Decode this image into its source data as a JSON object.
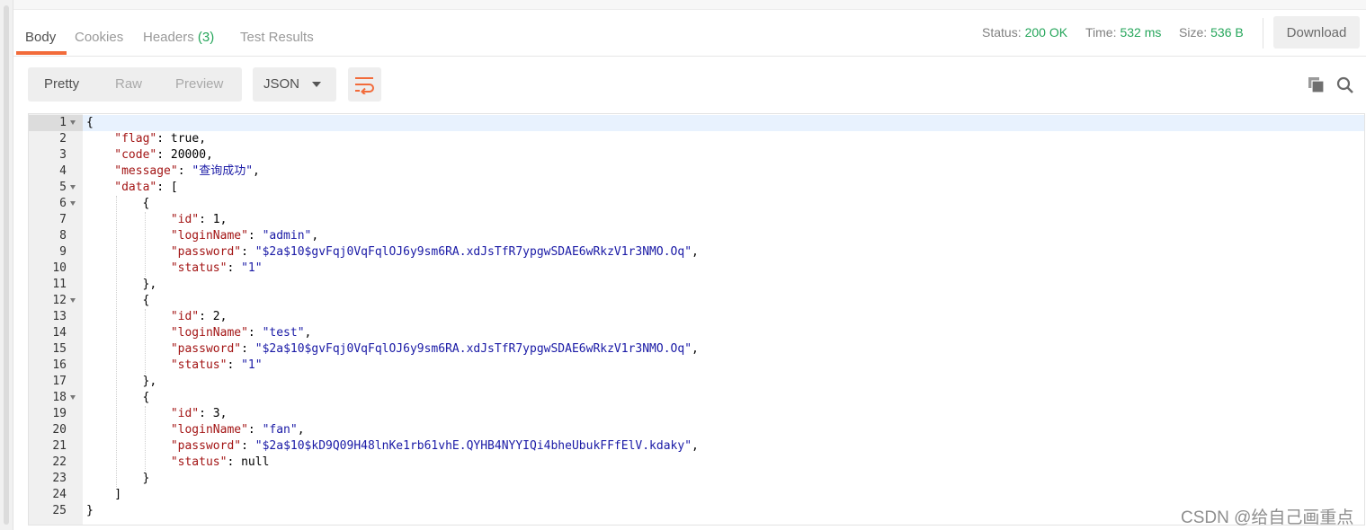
{
  "tabs": [
    {
      "label": "Body"
    },
    {
      "label": "Cookies"
    },
    {
      "label": "Headers",
      "count": "(3)"
    },
    {
      "label": "Test Results"
    }
  ],
  "response_meta": {
    "status_label": "Status:",
    "status_value": "200 OK",
    "time_label": "Time:",
    "time_value": "532 ms",
    "size_label": "Size:",
    "size_value": "536 B"
  },
  "download_label": "Download",
  "view_modes": [
    "Pretty",
    "Raw",
    "Preview"
  ],
  "format_select": {
    "selected": "JSON"
  },
  "icons": {
    "wrap": "wrap-lines-icon",
    "copy": "copy-icon",
    "search": "search-icon"
  },
  "colors": {
    "accent": "#f26b3a",
    "success": "#26a65b",
    "json_key": "#a31515",
    "json_string": "#1a1aa6"
  },
  "editor": {
    "lines": [
      {
        "n": "1",
        "indent": 0,
        "fold": true,
        "parts": [
          [
            "p",
            "{"
          ]
        ]
      },
      {
        "n": "2",
        "indent": 1,
        "parts": [
          [
            "k",
            "\"flag\""
          ],
          [
            "p",
            ": "
          ],
          [
            "l",
            "true"
          ],
          [
            "p",
            ","
          ]
        ]
      },
      {
        "n": "3",
        "indent": 1,
        "parts": [
          [
            "k",
            "\"code\""
          ],
          [
            "p",
            ": "
          ],
          [
            "l",
            "20000"
          ],
          [
            "p",
            ","
          ]
        ]
      },
      {
        "n": "4",
        "indent": 1,
        "parts": [
          [
            "k",
            "\"message\""
          ],
          [
            "p",
            ": "
          ],
          [
            "s",
            "\"查询成功\""
          ],
          [
            "p",
            ","
          ]
        ]
      },
      {
        "n": "5",
        "indent": 1,
        "fold": true,
        "parts": [
          [
            "k",
            "\"data\""
          ],
          [
            "p",
            ": ["
          ]
        ]
      },
      {
        "n": "6",
        "indent": 2,
        "fold": true,
        "parts": [
          [
            "p",
            "{"
          ]
        ]
      },
      {
        "n": "7",
        "indent": 3,
        "parts": [
          [
            "k",
            "\"id\""
          ],
          [
            "p",
            ": "
          ],
          [
            "l",
            "1"
          ],
          [
            "p",
            ","
          ]
        ]
      },
      {
        "n": "8",
        "indent": 3,
        "parts": [
          [
            "k",
            "\"loginName\""
          ],
          [
            "p",
            ": "
          ],
          [
            "s",
            "\"admin\""
          ],
          [
            "p",
            ","
          ]
        ]
      },
      {
        "n": "9",
        "indent": 3,
        "parts": [
          [
            "k",
            "\"password\""
          ],
          [
            "p",
            ": "
          ],
          [
            "s",
            "\"$2a$10$gvFqj0VqFqlOJ6y9sm6RA.xdJsTfR7ypgwSDAE6wRkzV1r3NMO.Oq\""
          ],
          [
            "p",
            ","
          ]
        ]
      },
      {
        "n": "10",
        "indent": 3,
        "parts": [
          [
            "k",
            "\"status\""
          ],
          [
            "p",
            ": "
          ],
          [
            "s",
            "\"1\""
          ]
        ]
      },
      {
        "n": "11",
        "indent": 2,
        "parts": [
          [
            "p",
            "},"
          ]
        ]
      },
      {
        "n": "12",
        "indent": 2,
        "fold": true,
        "parts": [
          [
            "p",
            "{"
          ]
        ]
      },
      {
        "n": "13",
        "indent": 3,
        "parts": [
          [
            "k",
            "\"id\""
          ],
          [
            "p",
            ": "
          ],
          [
            "l",
            "2"
          ],
          [
            "p",
            ","
          ]
        ]
      },
      {
        "n": "14",
        "indent": 3,
        "parts": [
          [
            "k",
            "\"loginName\""
          ],
          [
            "p",
            ": "
          ],
          [
            "s",
            "\"test\""
          ],
          [
            "p",
            ","
          ]
        ]
      },
      {
        "n": "15",
        "indent": 3,
        "parts": [
          [
            "k",
            "\"password\""
          ],
          [
            "p",
            ": "
          ],
          [
            "s",
            "\"$2a$10$gvFqj0VqFqlOJ6y9sm6RA.xdJsTfR7ypgwSDAE6wRkzV1r3NMO.Oq\""
          ],
          [
            "p",
            ","
          ]
        ]
      },
      {
        "n": "16",
        "indent": 3,
        "parts": [
          [
            "k",
            "\"status\""
          ],
          [
            "p",
            ": "
          ],
          [
            "s",
            "\"1\""
          ]
        ]
      },
      {
        "n": "17",
        "indent": 2,
        "parts": [
          [
            "p",
            "},"
          ]
        ]
      },
      {
        "n": "18",
        "indent": 2,
        "fold": true,
        "parts": [
          [
            "p",
            "{"
          ]
        ]
      },
      {
        "n": "19",
        "indent": 3,
        "parts": [
          [
            "k",
            "\"id\""
          ],
          [
            "p",
            ": "
          ],
          [
            "l",
            "3"
          ],
          [
            "p",
            ","
          ]
        ]
      },
      {
        "n": "20",
        "indent": 3,
        "parts": [
          [
            "k",
            "\"loginName\""
          ],
          [
            "p",
            ": "
          ],
          [
            "s",
            "\"fan\""
          ],
          [
            "p",
            ","
          ]
        ]
      },
      {
        "n": "21",
        "indent": 3,
        "parts": [
          [
            "k",
            "\"password\""
          ],
          [
            "p",
            ": "
          ],
          [
            "s",
            "\"$2a$10$kD9Q09H48lnKe1rb61vhE.QYHB4NYYIQi4bheUbukFFfElV.kdaky\""
          ],
          [
            "p",
            ","
          ]
        ]
      },
      {
        "n": "22",
        "indent": 3,
        "parts": [
          [
            "k",
            "\"status\""
          ],
          [
            "p",
            ": "
          ],
          [
            "l",
            "null"
          ]
        ]
      },
      {
        "n": "23",
        "indent": 2,
        "parts": [
          [
            "p",
            "}"
          ]
        ]
      },
      {
        "n": "24",
        "indent": 1,
        "parts": [
          [
            "p",
            "]"
          ]
        ]
      },
      {
        "n": "25",
        "indent": 0,
        "parts": [
          [
            "p",
            "}"
          ]
        ]
      }
    ]
  },
  "watermark": "CSDN @给自己画重点"
}
